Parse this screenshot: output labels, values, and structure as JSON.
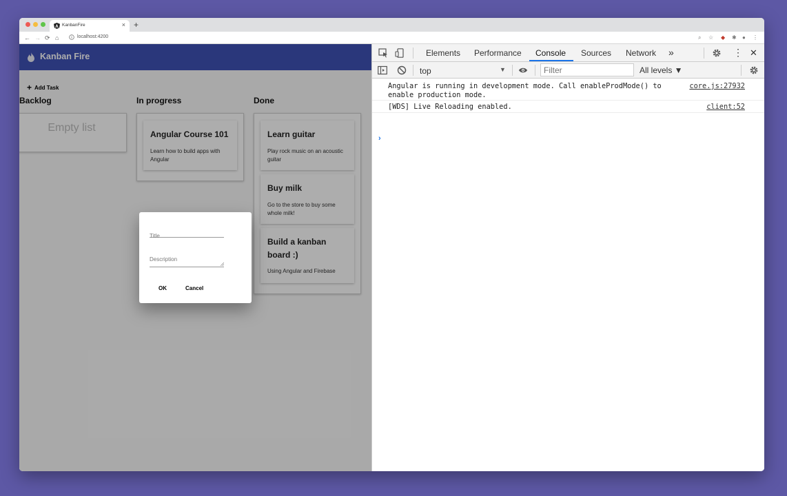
{
  "browser": {
    "tab_title": "KanbanFire",
    "tab_close": "×",
    "new_tab": "+",
    "url": "localhost:4200",
    "nav": {
      "back": "←",
      "forward": "→",
      "reload": "⟳",
      "home": "⌂"
    }
  },
  "app": {
    "title": "Kanban Fire",
    "add_task_label": "Add Task",
    "add_task_icon": "+",
    "columns": [
      {
        "title": "Backlog",
        "empty_text": "Empty list"
      },
      {
        "title": "In progress",
        "cards": [
          {
            "title": "Angular Course 101",
            "description": "Learn how to build apps with Angular"
          }
        ]
      },
      {
        "title": "Done",
        "cards": [
          {
            "title": "Learn guitar",
            "description": "Play rock music on an acoustic guitar"
          },
          {
            "title": "Buy milk",
            "description": "Go to the store to buy some whole milk!"
          },
          {
            "title": "Build a kanban board :)",
            "description": "Using Angular and Firebase"
          }
        ]
      }
    ],
    "dialog": {
      "title_label": "Title",
      "description_label": "Description",
      "ok_label": "OK",
      "cancel_label": "Cancel"
    },
    "colors": {
      "primary": "#3f51b5"
    }
  },
  "devtools": {
    "tabs": [
      "Elements",
      "Performance",
      "Console",
      "Sources",
      "Network"
    ],
    "active_tab": "Console",
    "more_tabs_icon": "»",
    "close_icon": "✕",
    "menu_icon": "⋮",
    "context": "top",
    "context_arrow": "▼",
    "filter_placeholder": "Filter",
    "levels": "All levels ▼",
    "messages": [
      {
        "text": "Angular is running in development mode. Call enableProdMode() to\nenable production mode.",
        "source": "core.js:27932"
      },
      {
        "text": "[WDS] Live Reloading enabled.",
        "source": "client:52"
      }
    ],
    "prompt": "›"
  }
}
